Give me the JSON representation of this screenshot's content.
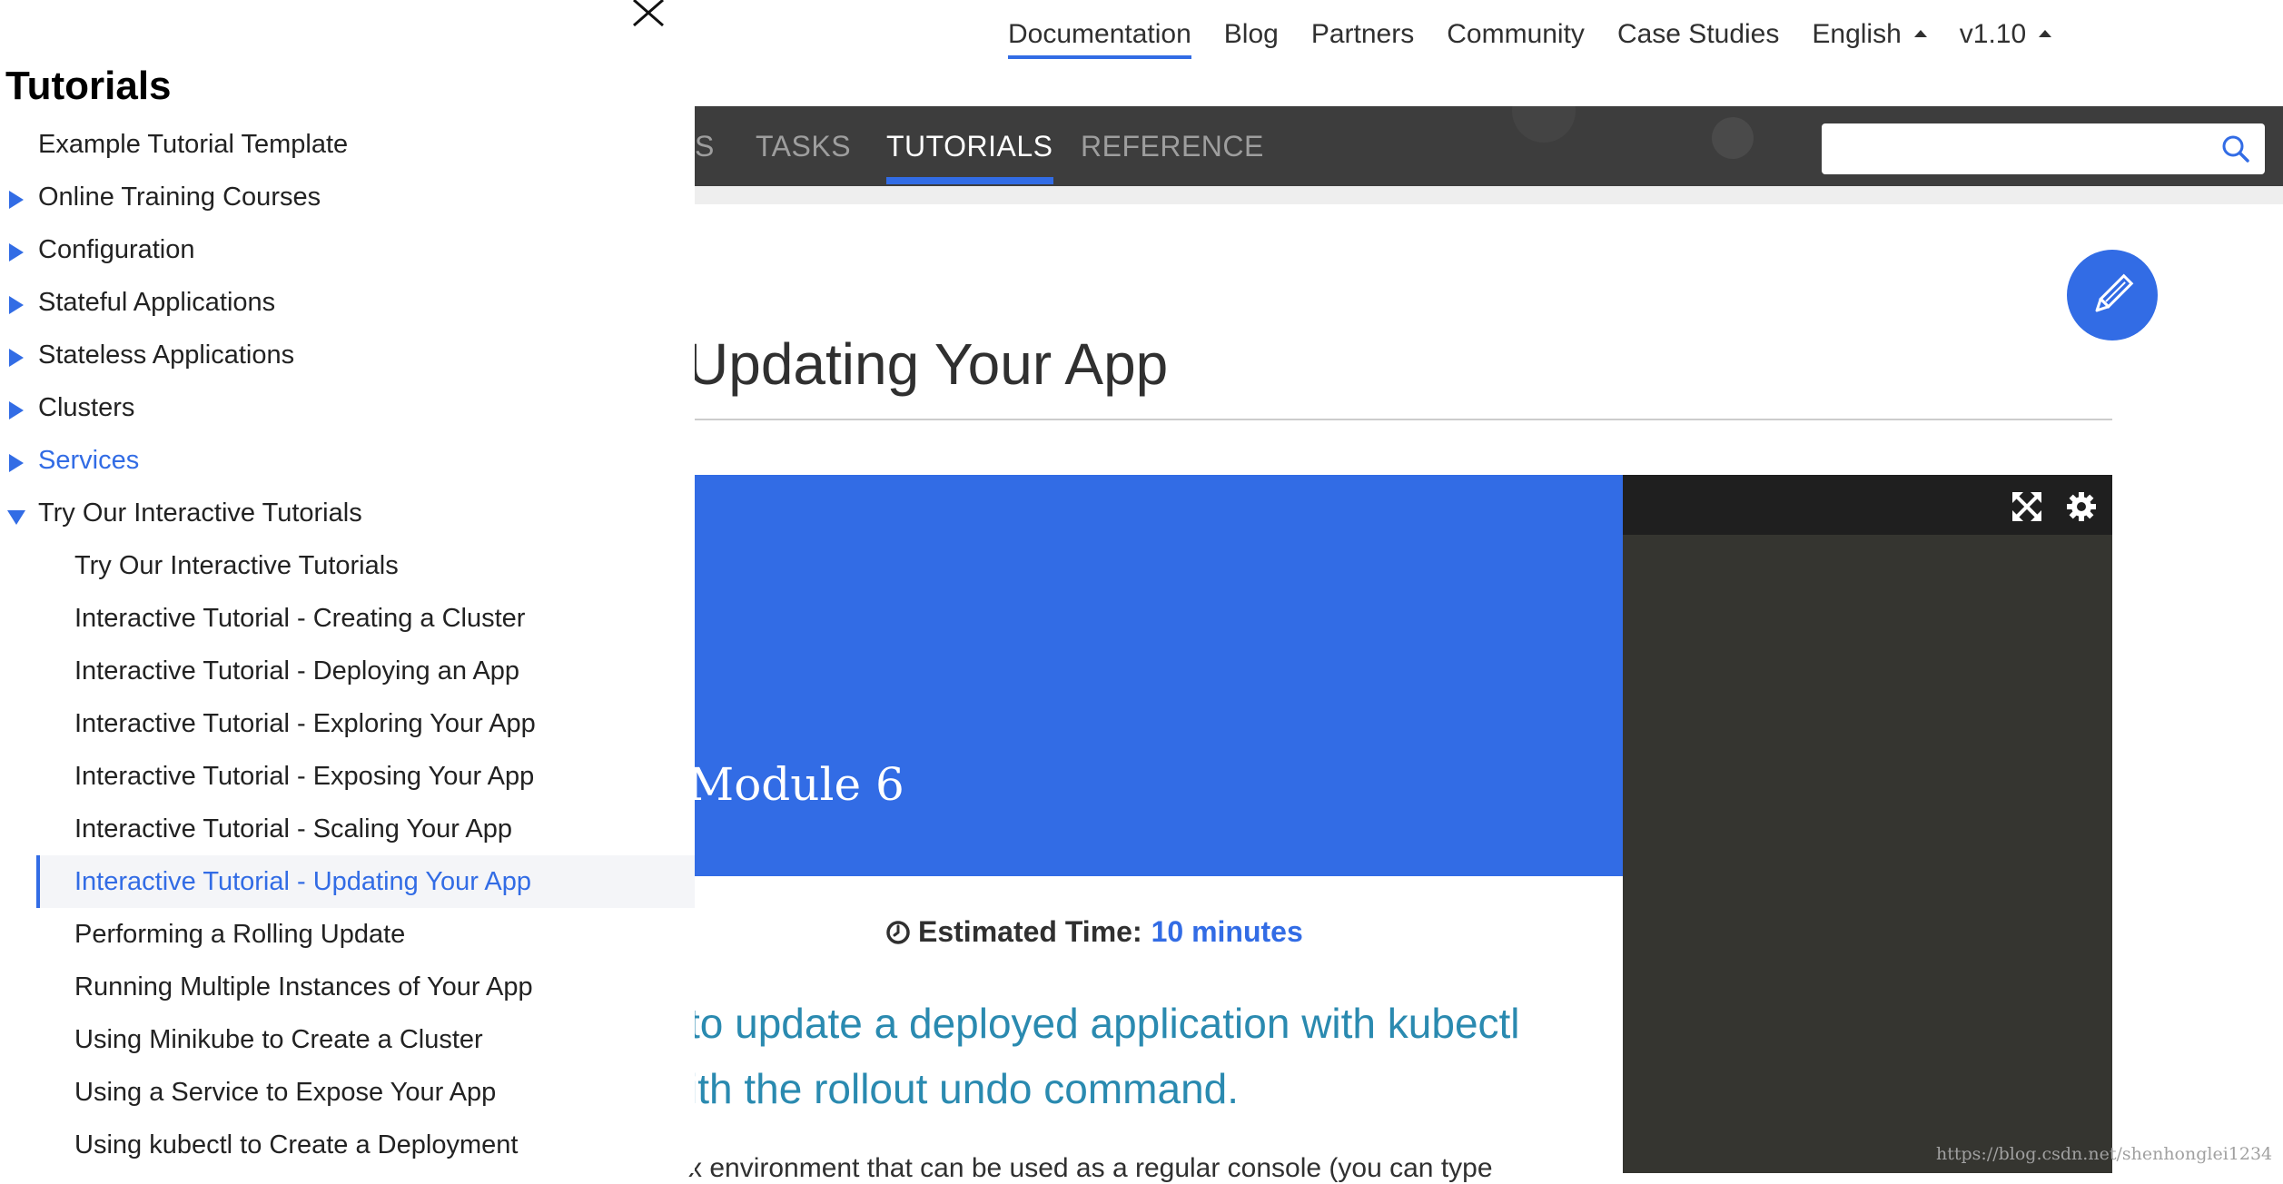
{
  "topnav": {
    "items": [
      "Documentation",
      "Blog",
      "Partners",
      "Community",
      "Case Studies"
    ],
    "language": "English",
    "version": "v1.10"
  },
  "tabs": [
    "S",
    "TASKS",
    "TUTORIALS",
    "REFERENCE"
  ],
  "search": {
    "placeholder": ""
  },
  "page": {
    "title": "Updating Your App",
    "module": "Module 6",
    "estimated_label": "Estimated Time:",
    "estimated_value": "10 minutes",
    "objective_line1": "to update a deployed application with kubectl",
    "objective_line2": "ith the rollout undo command.",
    "body_fragment": "x environment that can be used as a regular console (you can type"
  },
  "sidebar": {
    "title": "Tutorials",
    "items": [
      "Example Tutorial Template",
      "Online Training Courses",
      "Configuration",
      "Stateful Applications",
      "Stateless Applications",
      "Clusters",
      "Services",
      "Try Our Interactive Tutorials"
    ],
    "subitems": [
      "Try Our Interactive Tutorials",
      "Interactive Tutorial - Creating a Cluster",
      "Interactive Tutorial - Deploying an App",
      "Interactive Tutorial - Exploring Your App",
      "Interactive Tutorial - Exposing Your App",
      "Interactive Tutorial - Scaling Your App",
      "Interactive Tutorial - Updating Your App",
      "Performing a Rolling Update",
      "Running Multiple Instances of Your App",
      "Using Minikube to Create a Cluster",
      "Using a Service to Expose Your App",
      "Using kubectl to Create a Deployment"
    ]
  },
  "watermark": "https://blog.csdn.net/shenhonglei1234",
  "colors": {
    "accent": "#326ce5",
    "tabbar": "#3d3d3d",
    "terminal": "#353530",
    "objective": "#2a8ab0"
  },
  "icons": [
    "close-icon",
    "search-icon",
    "pencil-icon",
    "fullscreen-icon",
    "gear-icon",
    "clock-icon"
  ]
}
